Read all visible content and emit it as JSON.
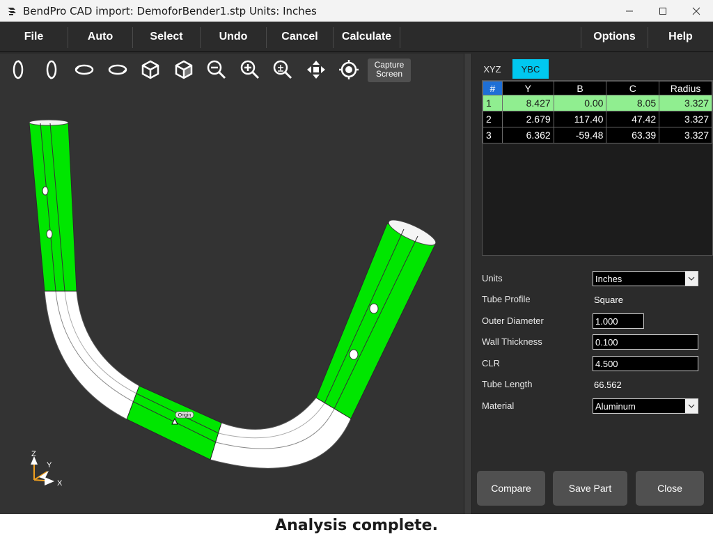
{
  "window": {
    "title": "BendPro CAD import: DemoforBender1.stp  Units: Inches"
  },
  "menu": {
    "file": "File",
    "auto": "Auto",
    "select": "Select",
    "undo": "Undo",
    "cancel": "Cancel",
    "calculate": "Calculate",
    "options": "Options",
    "help": "Help"
  },
  "toolbar": {
    "tools": [
      "rotate-x-icon",
      "rotate-y-icon",
      "rotate-ccw-icon",
      "rotate-cw-icon",
      "iso-view-icon",
      "iso-view-alt-icon",
      "zoom-out-icon",
      "zoom-in-icon",
      "zoom-fit-icon",
      "pan-icon",
      "center-target-icon"
    ],
    "capture_line1": "Capture",
    "capture_line2": "Screen"
  },
  "viewport": {
    "origin_label": "Origin",
    "axes": {
      "z": "Z",
      "y": "Y",
      "x": "X"
    },
    "colors": {
      "straight": "#00e600",
      "bend": "#ffffff",
      "background": "#333333"
    }
  },
  "tabs": {
    "xyz": "XYZ",
    "ybc": "YBC",
    "active": "YBC",
    "active_color": "#00c8f0"
  },
  "table": {
    "headers": [
      "#",
      "Y",
      "B",
      "C",
      "Radius"
    ],
    "rows": [
      [
        "1",
        "8.427",
        "0.00",
        "8.05",
        "3.327"
      ],
      [
        "2",
        "2.679",
        "117.40",
        "47.42",
        "3.327"
      ],
      [
        "3",
        "6.362",
        "-59.48",
        "63.39",
        "3.327"
      ]
    ],
    "selected_row": 0,
    "selected_color": "#90ee90"
  },
  "properties": {
    "units_label": "Units",
    "units_value": "Inches",
    "profile_label": "Tube Profile",
    "profile_value": "Square",
    "od_label": "Outer Diameter",
    "od_value": "1.000",
    "wall_label": "Wall Thickness",
    "wall_value": "0.100",
    "clr_label": "CLR",
    "clr_value": "4.500",
    "length_label": "Tube Length",
    "length_value": "66.562",
    "material_label": "Material",
    "material_value": "Aluminum"
  },
  "actions": {
    "compare": "Compare",
    "save_part": "Save Part",
    "close": "Close"
  },
  "status": {
    "message": "Analysis complete."
  }
}
